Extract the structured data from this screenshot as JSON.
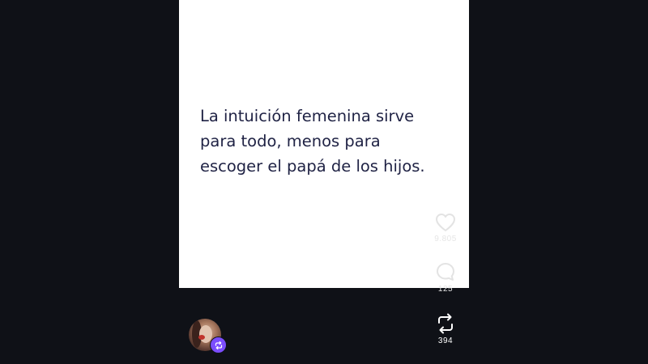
{
  "post": {
    "text": "La intuición femenina sirve\npara todo, menos para\nescoger el papá de los hijos."
  },
  "actions": {
    "likes": "9.805",
    "comments": "125",
    "reposts": "394"
  },
  "icons": {
    "like": "heart-icon",
    "comment": "comment-bubble-icon",
    "repost": "repost-icon",
    "badge": "repost-badge-icon"
  },
  "colors": {
    "background": "#0f1117",
    "card": "#ffffff",
    "quote_text": "#1f2244",
    "badge": "#7b4dff"
  }
}
